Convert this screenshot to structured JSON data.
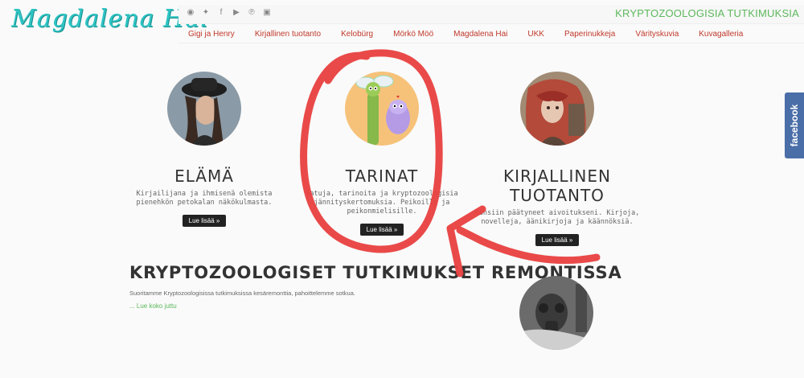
{
  "logo": "Magdalena Hai",
  "tagline": "KRYPTOZOOLOGISIA TUTKIMUKSIA",
  "social_icons": [
    "rss-icon",
    "twitter-icon",
    "facebook-icon",
    "youtube-icon",
    "pinterest-icon",
    "linkedin-icon"
  ],
  "nav": [
    "Gigi ja Henry",
    "Kirjallinen tuotanto",
    "Kelobürg",
    "Mörkö Möö",
    "Magdalena Hai",
    "UKK",
    "Paperinukkeja",
    "Värityskuvia",
    "Kuvagalleria"
  ],
  "cards": [
    {
      "title": "ELÄMÄ",
      "text": "Kirjailijana ja ihmisenä olemista pienehkön petokalan näkökulmasta.",
      "button": "Lue lisää »"
    },
    {
      "title": "TARINAT",
      "text": "Satuja, tarinoita ja kryptozoologisia jännityskertomuksia. Peikoille ja peikonmielisille.",
      "button": "Lue lisää »"
    },
    {
      "title": "KIRJALLINEN TUOTANTO",
      "text": "Kansiin päätyneet aivoitukseni. Kirjoja, novelleja, äänikirjoja ja käännöksiä.",
      "button": "Lue lisää »"
    }
  ],
  "post": {
    "title": "KRYPTOZOOLOGISET TUTKIMUKSET REMONTISSA",
    "excerpt": "Suoritamme Kryptozoologisissa tutkimuksissa kesäremonttia, pahoittelemme sotkua.",
    "more": "... Lue koko juttu"
  },
  "facebook_tab": "facebook",
  "colors": {
    "accent_green": "#5cb85c",
    "nav_red": "#c0392b",
    "logo_teal": "#2ec4c4",
    "annotation_red": "#e8403f",
    "facebook_blue": "#4a6ea8"
  }
}
